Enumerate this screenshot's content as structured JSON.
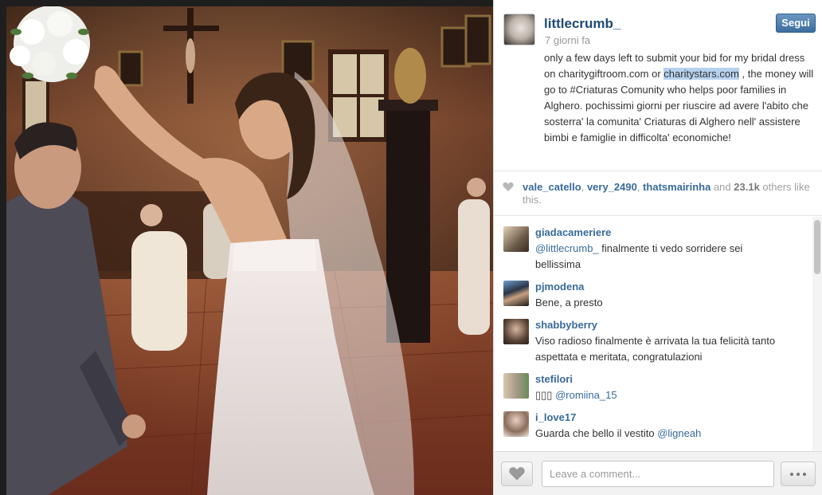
{
  "post": {
    "username": "littlecrumb_",
    "time": "7 giorni fa",
    "follow_label": "Segui",
    "caption_before": "only a few days left to submit your bid for my bridal dress on charitygiftroom.com or ",
    "caption_highlight": "charitystars.com",
    "caption_after": " , the money will go to #Criaturas Comunity who helps poor families in Alghero. pochissimi giorni per riuscire ad avere l'abito che sosterra' la comunita' Criaturas di Alghero nell' assistere bimbi e famiglie in difficolta' economiche!"
  },
  "likes": {
    "user1": "vale_catello",
    "sep1": ", ",
    "user2": "very_2490",
    "sep2": ", ",
    "user3": "thatsmairinha",
    "and": " and ",
    "count": "23.1k",
    "rest": " others like this."
  },
  "comments": [
    {
      "user": "giadacameriere",
      "mention": "@littlecrumb_",
      "text": " finalmente ti vedo sorridere sei bellissima",
      "avatar_color": "#6b5a48"
    },
    {
      "user": "pjmodena",
      "mention": "",
      "text": "Bene, a presto",
      "avatar_color": "#2b3344"
    },
    {
      "user": "shabbyberry",
      "mention": "",
      "text": "Viso radioso finalmente è arrivata la tua felicità tanto aspettata e meritata, congratulazioni",
      "avatar_color": "#5a4436"
    },
    {
      "user": "stefilori",
      "prefix": "",
      "mention": "@romiina_15",
      "text": "",
      "avatar_color": "#a89a88"
    },
    {
      "user": "i_love17",
      "mention": "@ligneah",
      "text_before": "Guarda che bello il vestito ",
      "avatar_color": "#8a6e5c"
    }
  ],
  "footer": {
    "comment_placeholder": "Leave a comment...",
    "comment_value": ""
  },
  "icons": {
    "like": "heart-icon",
    "more": "ellipsis-icon",
    "likes_indicator": "heart-icon"
  },
  "colors": {
    "link_blue": "#3a6b9a",
    "username_blue": "#1f4a74",
    "follow_button": "#4a7aa8",
    "highlight": "#b7d2f0"
  }
}
